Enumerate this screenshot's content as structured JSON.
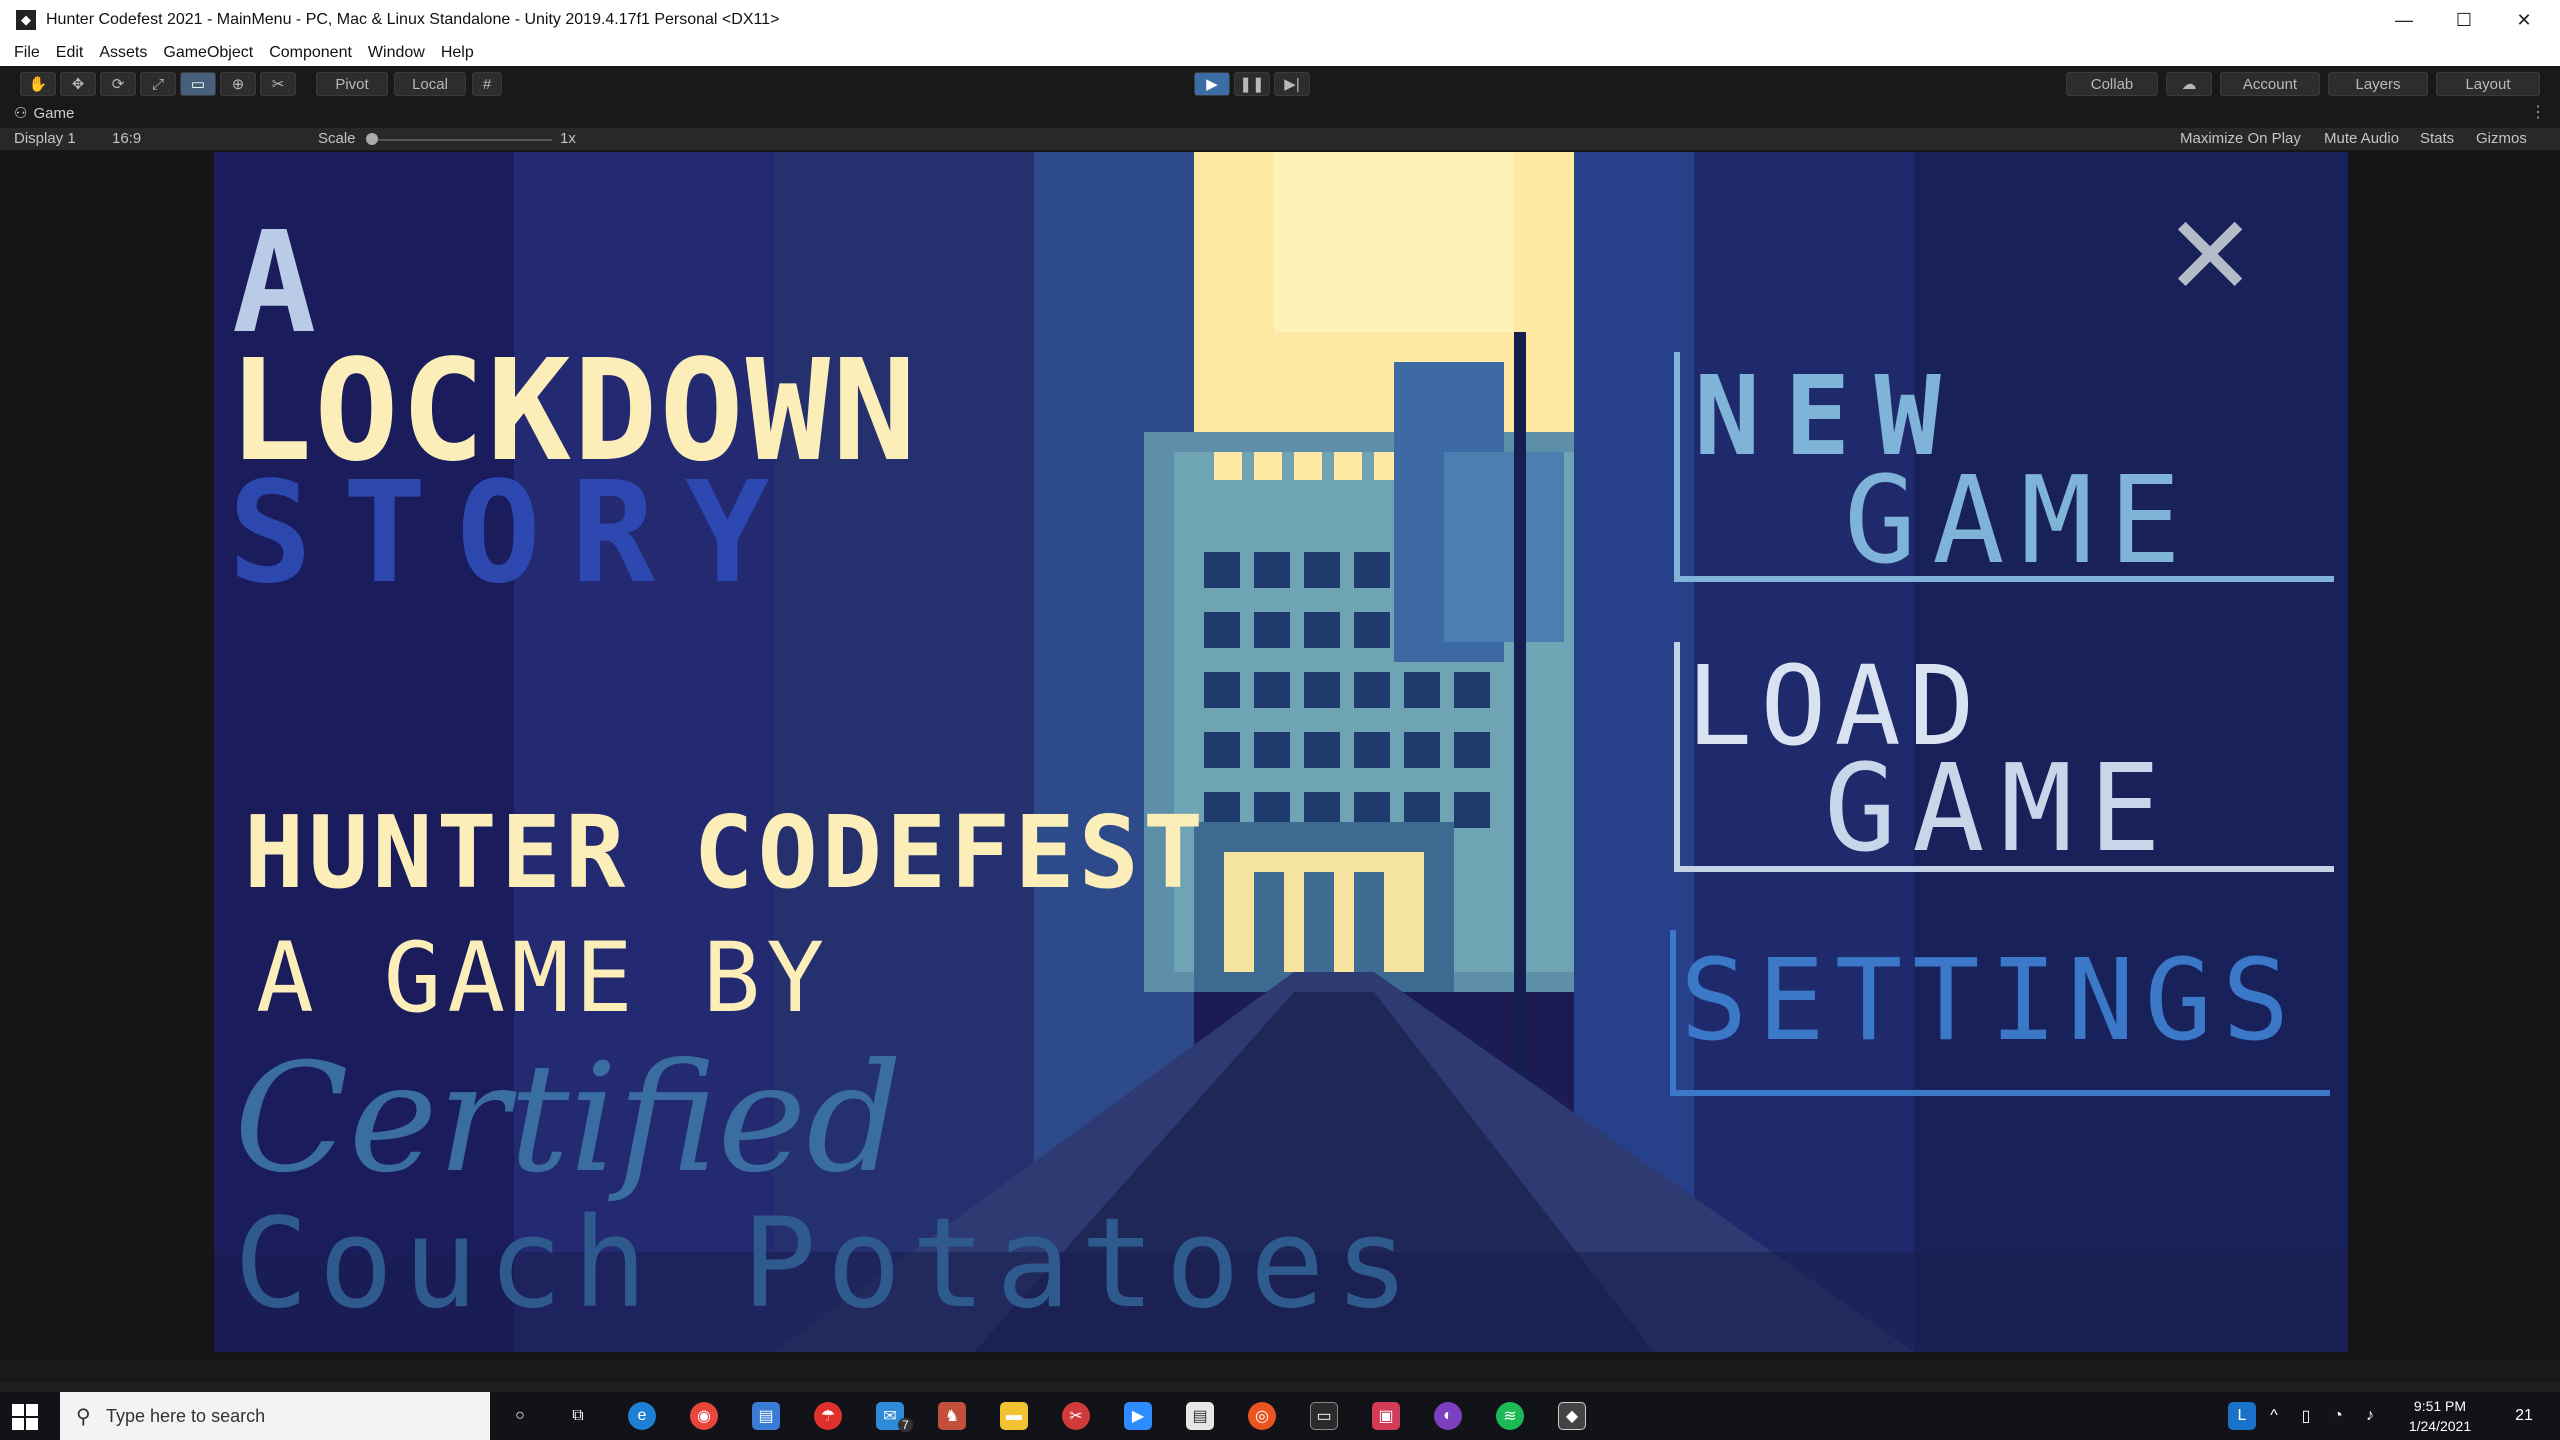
{
  "window": {
    "title": "Hunter Codefest 2021 - MainMenu - PC, Mac & Linux Standalone - Unity 2019.4.17f1 Personal <DX11>",
    "minimize_glyph": "—",
    "maximize_glyph": "☐",
    "close_glyph": "✕"
  },
  "menu": {
    "items": [
      "File",
      "Edit",
      "Assets",
      "GameObject",
      "Component",
      "Window",
      "Help"
    ]
  },
  "toolbar": {
    "pivot_label": "Pivot",
    "local_label": "Local",
    "collab_label": "Collab",
    "account_label": "Account",
    "layers_label": "Layers",
    "layout_label": "Layout"
  },
  "game_tab": {
    "label": "Game",
    "display": "Display 1",
    "aspect": "16:9",
    "scale_label": "Scale",
    "scale_value": "1x",
    "maximize_on_play": "Maximize On Play",
    "mute_audio": "Mute Audio",
    "stats": "Stats",
    "gizmos": "Gizmos"
  },
  "game": {
    "title_line1": "A",
    "title_line2": "LOCKDOWN",
    "title_line3": "STORY",
    "codefest": "HUNTER CODEFEST",
    "by_line": "A GAME BY",
    "team_line1": "Certified",
    "team_line2": "Couch Potatoes",
    "close_glyph": "✕",
    "menu": {
      "new_1": "NEW",
      "new_2": "GAME",
      "load_1": "LOAD",
      "load_2": "GAME",
      "settings": "SETTINGS"
    }
  },
  "taskbar": {
    "search_placeholder": "Type here to search",
    "time": "9:51 PM",
    "date": "1/24/2021",
    "notifications": "21",
    "mail_badge": "7"
  },
  "colors": {
    "editor_dark": "#191919",
    "scene_navy": "#1c1c55",
    "title_cream": "#fbeeb8",
    "story_blue": "#2f4db8",
    "menu_light_blue": "#7fb3d8",
    "settings_blue": "#3c78c8"
  }
}
